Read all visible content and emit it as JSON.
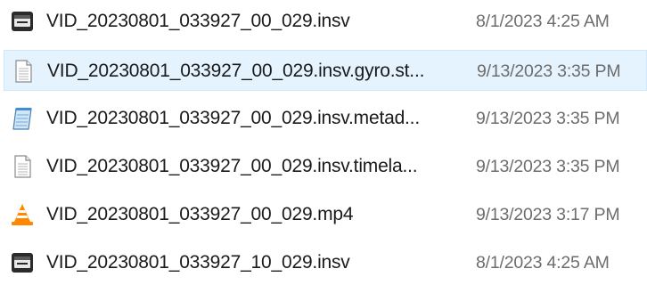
{
  "files": [
    {
      "name": "VID_20230801_033927_00_029.insv",
      "date": "8/1/2023 4:25 AM",
      "icon": "insv-file-icon",
      "selected": false
    },
    {
      "name": "VID_20230801_033927_00_029.insv.gyro.st...",
      "date": "9/13/2023 3:35 PM",
      "icon": "generic-file-icon",
      "selected": true
    },
    {
      "name": "VID_20230801_033927_00_029.insv.metad...",
      "date": "9/13/2023 3:35 PM",
      "icon": "notepad-file-icon",
      "selected": false
    },
    {
      "name": "VID_20230801_033927_00_029.insv.timela...",
      "date": "9/13/2023 3:35 PM",
      "icon": "generic-file-icon",
      "selected": false
    },
    {
      "name": "VID_20230801_033927_00_029.mp4",
      "date": "9/13/2023 3:17 PM",
      "icon": "vlc-file-icon",
      "selected": false
    },
    {
      "name": "VID_20230801_033927_10_029.insv",
      "date": "8/1/2023 4:25 AM",
      "icon": "insv-file-icon",
      "selected": false
    }
  ],
  "colors": {
    "selection_bg": "#e5f3ff",
    "selection_border": "#cce8ff",
    "name_text": "#1a1a1a",
    "date_text": "#6d6d6d",
    "vlc_orange": "#ff8800"
  }
}
